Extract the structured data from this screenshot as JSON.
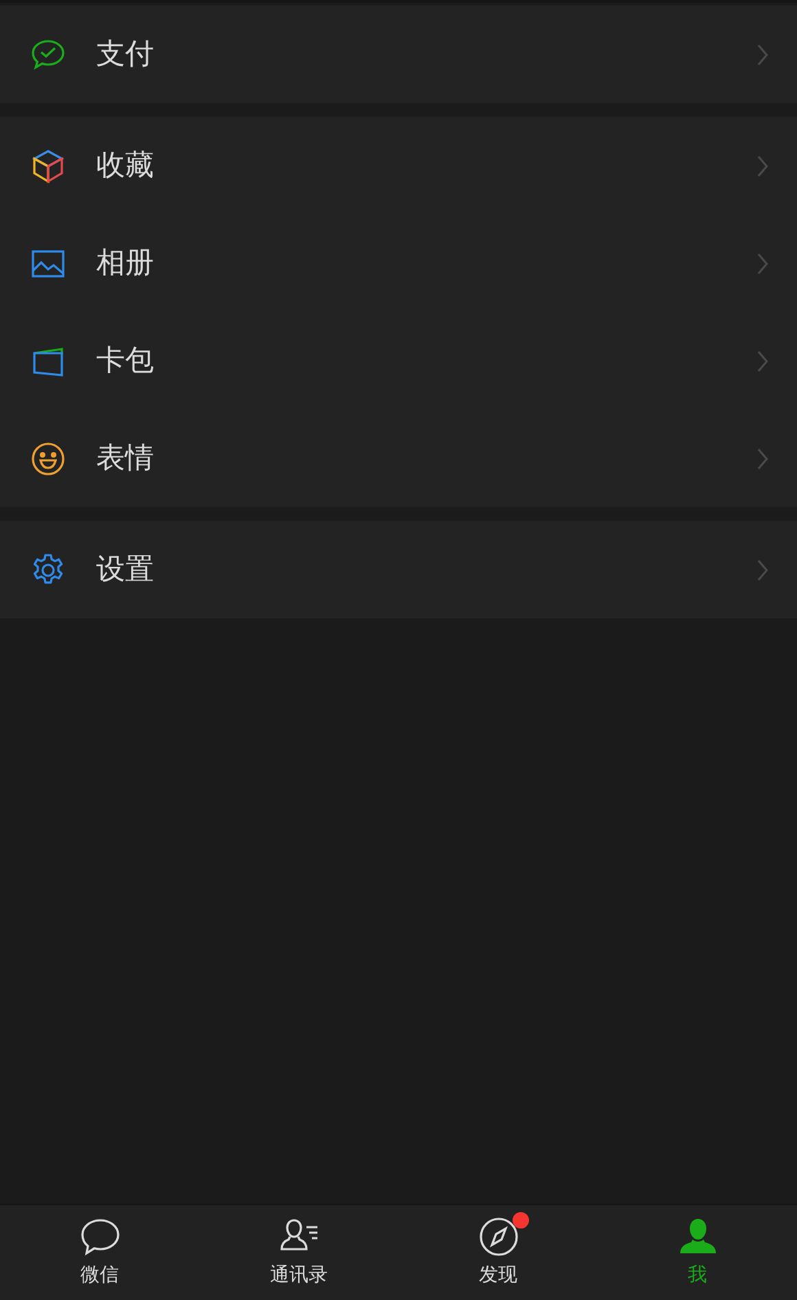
{
  "menu_groups": [
    {
      "items": [
        {
          "kind": "pay",
          "label": "支付"
        }
      ]
    },
    {
      "items": [
        {
          "kind": "favorites",
          "label": "收藏"
        },
        {
          "kind": "album",
          "label": "相册"
        },
        {
          "kind": "cards",
          "label": "卡包"
        },
        {
          "kind": "stickers",
          "label": "表情"
        }
      ]
    },
    {
      "items": [
        {
          "kind": "settings",
          "label": "设置"
        }
      ]
    }
  ],
  "tab_bar": [
    {
      "kind": "chats",
      "label": "微信",
      "selected": false,
      "badge": false
    },
    {
      "kind": "contacts",
      "label": "通讯录",
      "selected": false,
      "badge": false
    },
    {
      "kind": "discover",
      "label": "发现",
      "selected": false,
      "badge": true
    },
    {
      "kind": "me",
      "label": "我",
      "selected": true,
      "badge": false
    }
  ]
}
